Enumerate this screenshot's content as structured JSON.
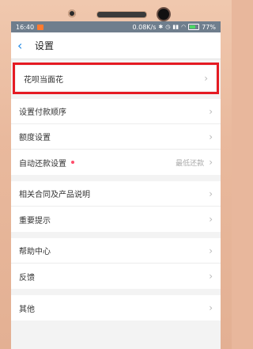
{
  "status_bar": {
    "time": "16:40",
    "network_speed": "0.08K/s",
    "battery_percent": "77%"
  },
  "header": {
    "back_icon": "chevron-left-icon",
    "title": "设置"
  },
  "groups": [
    {
      "items": [
        {
          "label": "花呗当面花"
        }
      ]
    },
    {
      "items": [
        {
          "label": "设置付款顺序"
        },
        {
          "label": "额度设置"
        },
        {
          "label": "自动还款设置",
          "value": "最低还款",
          "has_dot": true
        }
      ]
    },
    {
      "items": [
        {
          "label": "相关合同及产品说明"
        },
        {
          "label": "重要提示"
        }
      ]
    },
    {
      "items": [
        {
          "label": "帮助中心"
        },
        {
          "label": "反馈"
        }
      ]
    },
    {
      "items": [
        {
          "label": "其他"
        }
      ]
    }
  ],
  "colors": {
    "accent": "#1e88e5",
    "highlight": "#e51b23",
    "status_bar": "#6f7e8d",
    "dot": "#ff4d6b"
  }
}
